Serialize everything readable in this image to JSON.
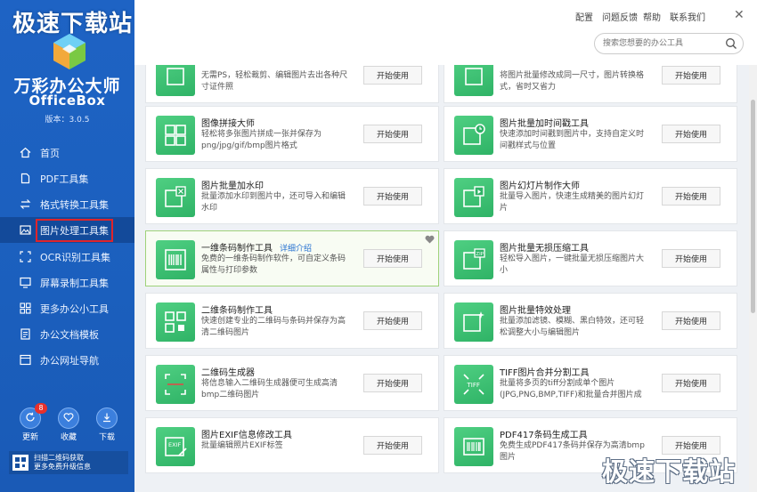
{
  "watermark": "极速下载站",
  "app": {
    "name": "万彩办公大师",
    "sub": "OfficeBox",
    "version": "版本：3.0.5"
  },
  "nav": [
    {
      "label": "首页",
      "icon": "home-icon"
    },
    {
      "label": "PDF工具集",
      "icon": "pdf-icon"
    },
    {
      "label": "格式转换工具集",
      "icon": "convert-icon"
    },
    {
      "label": "图片处理工具集",
      "icon": "image-icon"
    },
    {
      "label": "OCR识别工具集",
      "icon": "ocr-icon"
    },
    {
      "label": "屏幕录制工具集",
      "icon": "monitor-icon"
    },
    {
      "label": "更多办公小工具",
      "icon": "grid-icon"
    },
    {
      "label": "办公文档模板",
      "icon": "document-icon"
    },
    {
      "label": "办公网址导航",
      "icon": "browser-icon"
    }
  ],
  "active_nav": "图片处理工具集",
  "bottom": {
    "update": "更新",
    "badge": "8",
    "favorite": "收藏",
    "download": "下载"
  },
  "scan": {
    "line1": "扫描二维码获取",
    "line2": "更多免费升级信息"
  },
  "top_links": {
    "settings": "配置",
    "feedback": "问题反馈",
    "help": "帮助",
    "contact": "联系我们"
  },
  "search": {
    "placeholder": "搜索您想要的办公工具"
  },
  "open_label": "开始使用",
  "detail_link": "详细介绍",
  "cards": [
    {
      "title": "",
      "desc": "无需PS，轻松裁剪、编辑图片去出各种尺寸证件照"
    },
    {
      "title": "",
      "desc": "将图片批量修改成同一尺寸，图片转换格式，省时又省力"
    },
    {
      "title": "图像拼接大师",
      "desc": "轻松将多张图片拼成一张并保存为png/jpg/gif/bmp图片格式"
    },
    {
      "title": "图片批量加时间戳工具",
      "desc": "快速添加时间戳到图片中，支持自定义时间戳样式与位置"
    },
    {
      "title": "图片批量加水印",
      "desc": "批量添加水印到图片中，还可导入和编辑水印"
    },
    {
      "title": "图片幻灯片制作大师",
      "desc": "批量导入图片，快速生成精美的图片幻灯片"
    },
    {
      "title": "一维条码制作工具",
      "desc": "免费的一维条码制作软件，可自定义条码属性与打印参数"
    },
    {
      "title": "图片批量无损压缩工具",
      "desc": "轻松导入图片，一键批量无损压缩图片大小"
    },
    {
      "title": "二维条码制作工具",
      "desc": "快速创建专业的二维码与条码并保存为高清二维码图片"
    },
    {
      "title": "图片批量特效处理",
      "desc": "批量添加滤镜、模糊、黑白特效，还可轻松调整大小与编辑图片"
    },
    {
      "title": "二维码生成器",
      "desc": "将信息输入二维码生成器便可生成高清bmp二维码图片"
    },
    {
      "title": "TIFF图片合并分割工具",
      "desc": "批量将多页的tiff分割成单个图片(JPG,PNG,BMP,TIFF)和批量合并图片成"
    },
    {
      "title": "图片EXIF信息修改工具",
      "desc": "批量编辑照片EXIF标签"
    },
    {
      "title": "PDF417条码生成工具",
      "desc": "免费生成PDF417条码并保存为高清bmp图片"
    }
  ],
  "colors": {
    "sidebar": "#1c5ebf",
    "active": "#134a9a",
    "accent_green": "#3cc174",
    "highlight_border": "#9fd27a",
    "link": "#2a74d1"
  }
}
